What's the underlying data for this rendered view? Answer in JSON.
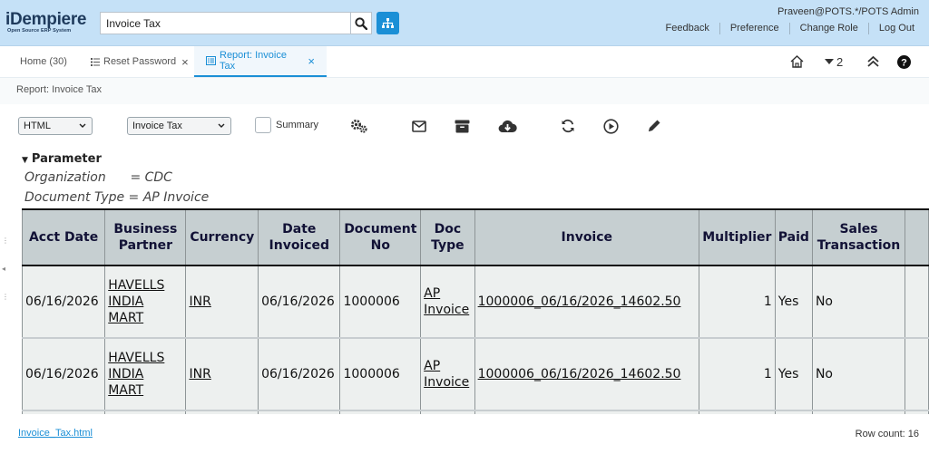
{
  "header": {
    "logo_text": "iDempiere",
    "logo_tagline": "Open Source ERP System",
    "search_value": "Invoice Tax",
    "user": "Praveen@POTS.*/POTS Admin",
    "links": [
      "Feedback",
      "Preference",
      "Change Role",
      "Log Out"
    ]
  },
  "tabs": [
    {
      "label": "Home (30)",
      "active": false
    },
    {
      "label": "Reset Password",
      "active": false,
      "close": "×"
    },
    {
      "label": "Report: Invoice Tax",
      "active": true,
      "close": "×"
    }
  ],
  "tab_tools": {
    "icons": [
      "home-icon",
      "caret-down-icon",
      "double-chevron-up-icon",
      "help-icon"
    ],
    "window_count": "2"
  },
  "breadcrumb": "Report: Invoice Tax",
  "toolbar": {
    "format_select": "HTML",
    "report_select": "Invoice Tax",
    "summary_label": "Summary",
    "summary_checked": false,
    "icons": [
      "gears-icon",
      "envelope-icon",
      "archive-icon",
      "cloud-download-icon",
      "refresh-icon",
      "play-icon",
      "pencil-icon"
    ]
  },
  "parameter": {
    "title": "Parameter",
    "lines": [
      "Organization      = CDC",
      "Document Type = AP Invoice"
    ]
  },
  "table": {
    "headers": [
      [
        "Acct Date"
      ],
      [
        "Business",
        "Partner"
      ],
      [
        "Currency"
      ],
      [
        "Date",
        "Invoiced"
      ],
      [
        "Document",
        "No"
      ],
      [
        "Doc",
        "Type"
      ],
      [
        "Invoice"
      ],
      [
        "Multiplier"
      ],
      [
        "Paid"
      ],
      [
        "Sales",
        "Transaction"
      ]
    ],
    "rows": [
      {
        "acct_date": "06/16/2026",
        "bp_line1": "HAVELLS",
        "bp_line2": "INDIA MART",
        "currency": "INR",
        "date_invoiced": "06/16/2026",
        "document_no": "1000006",
        "doctype_line1": "AP",
        "doctype_line2": "Invoice",
        "invoice": "1000006_06/16/2026_14602.50",
        "multiplier": "1",
        "paid": "Yes",
        "sales_tx": "No"
      },
      {
        "acct_date": "06/16/2026",
        "bp_line1": "HAVELLS",
        "bp_line2": "INDIA MART",
        "currency": "INR",
        "date_invoiced": "06/16/2026",
        "document_no": "1000006",
        "doctype_line1": "AP",
        "doctype_line2": "Invoice",
        "invoice": "1000006_06/16/2026_14602.50",
        "multiplier": "1",
        "paid": "Yes",
        "sales_tx": "No"
      }
    ]
  },
  "footer": {
    "file_link": "Invoice_Tax.html",
    "row_count": "Row count: 16"
  },
  "colors": {
    "header_bg": "#c5e1f7",
    "accent": "#1b8fd6",
    "table_header_bg": "#c6cfd1",
    "table_cell_bg": "#edf0ef"
  }
}
